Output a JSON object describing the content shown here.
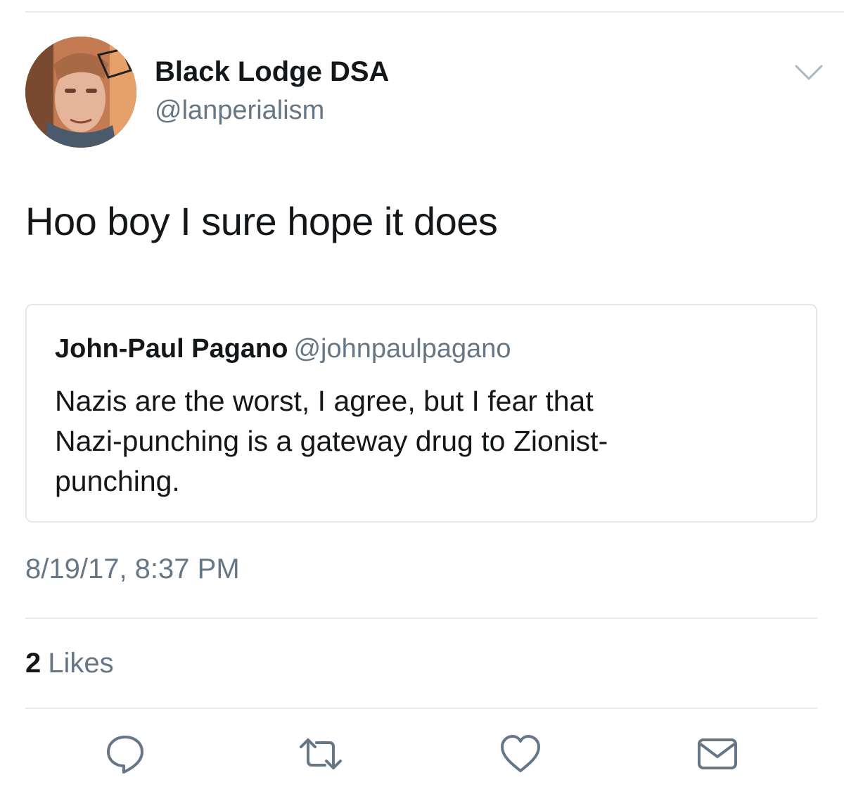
{
  "tweet": {
    "author": {
      "display_name": "Black Lodge DSA",
      "handle": "@lanperialism",
      "avatar_icon": "profile-photo"
    },
    "menu_icon": "chevron-down-icon",
    "text": "Hoo boy I sure hope it does",
    "quoted_tweet": {
      "display_name": "John-Paul Pagano",
      "handle": "@johnpaulpagano",
      "text_lines": [
        "Nazis are the worst, I agree, but I fear that",
        "Nazi-punching is a gateway drug to Zionist-",
        "punching."
      ]
    },
    "timestamp": "8/19/17, 8:37 PM",
    "likes": {
      "count": "2",
      "label": "Likes"
    },
    "actions": [
      {
        "name": "reply",
        "icon": "reply-icon"
      },
      {
        "name": "retweet",
        "icon": "retweet-icon"
      },
      {
        "name": "like",
        "icon": "heart-icon"
      },
      {
        "name": "direct-message",
        "icon": "envelope-icon"
      }
    ]
  },
  "colors": {
    "primary_text": "#14171a",
    "secondary_text": "#657786",
    "divider": "#e6ecf0",
    "icon": "#657786"
  }
}
